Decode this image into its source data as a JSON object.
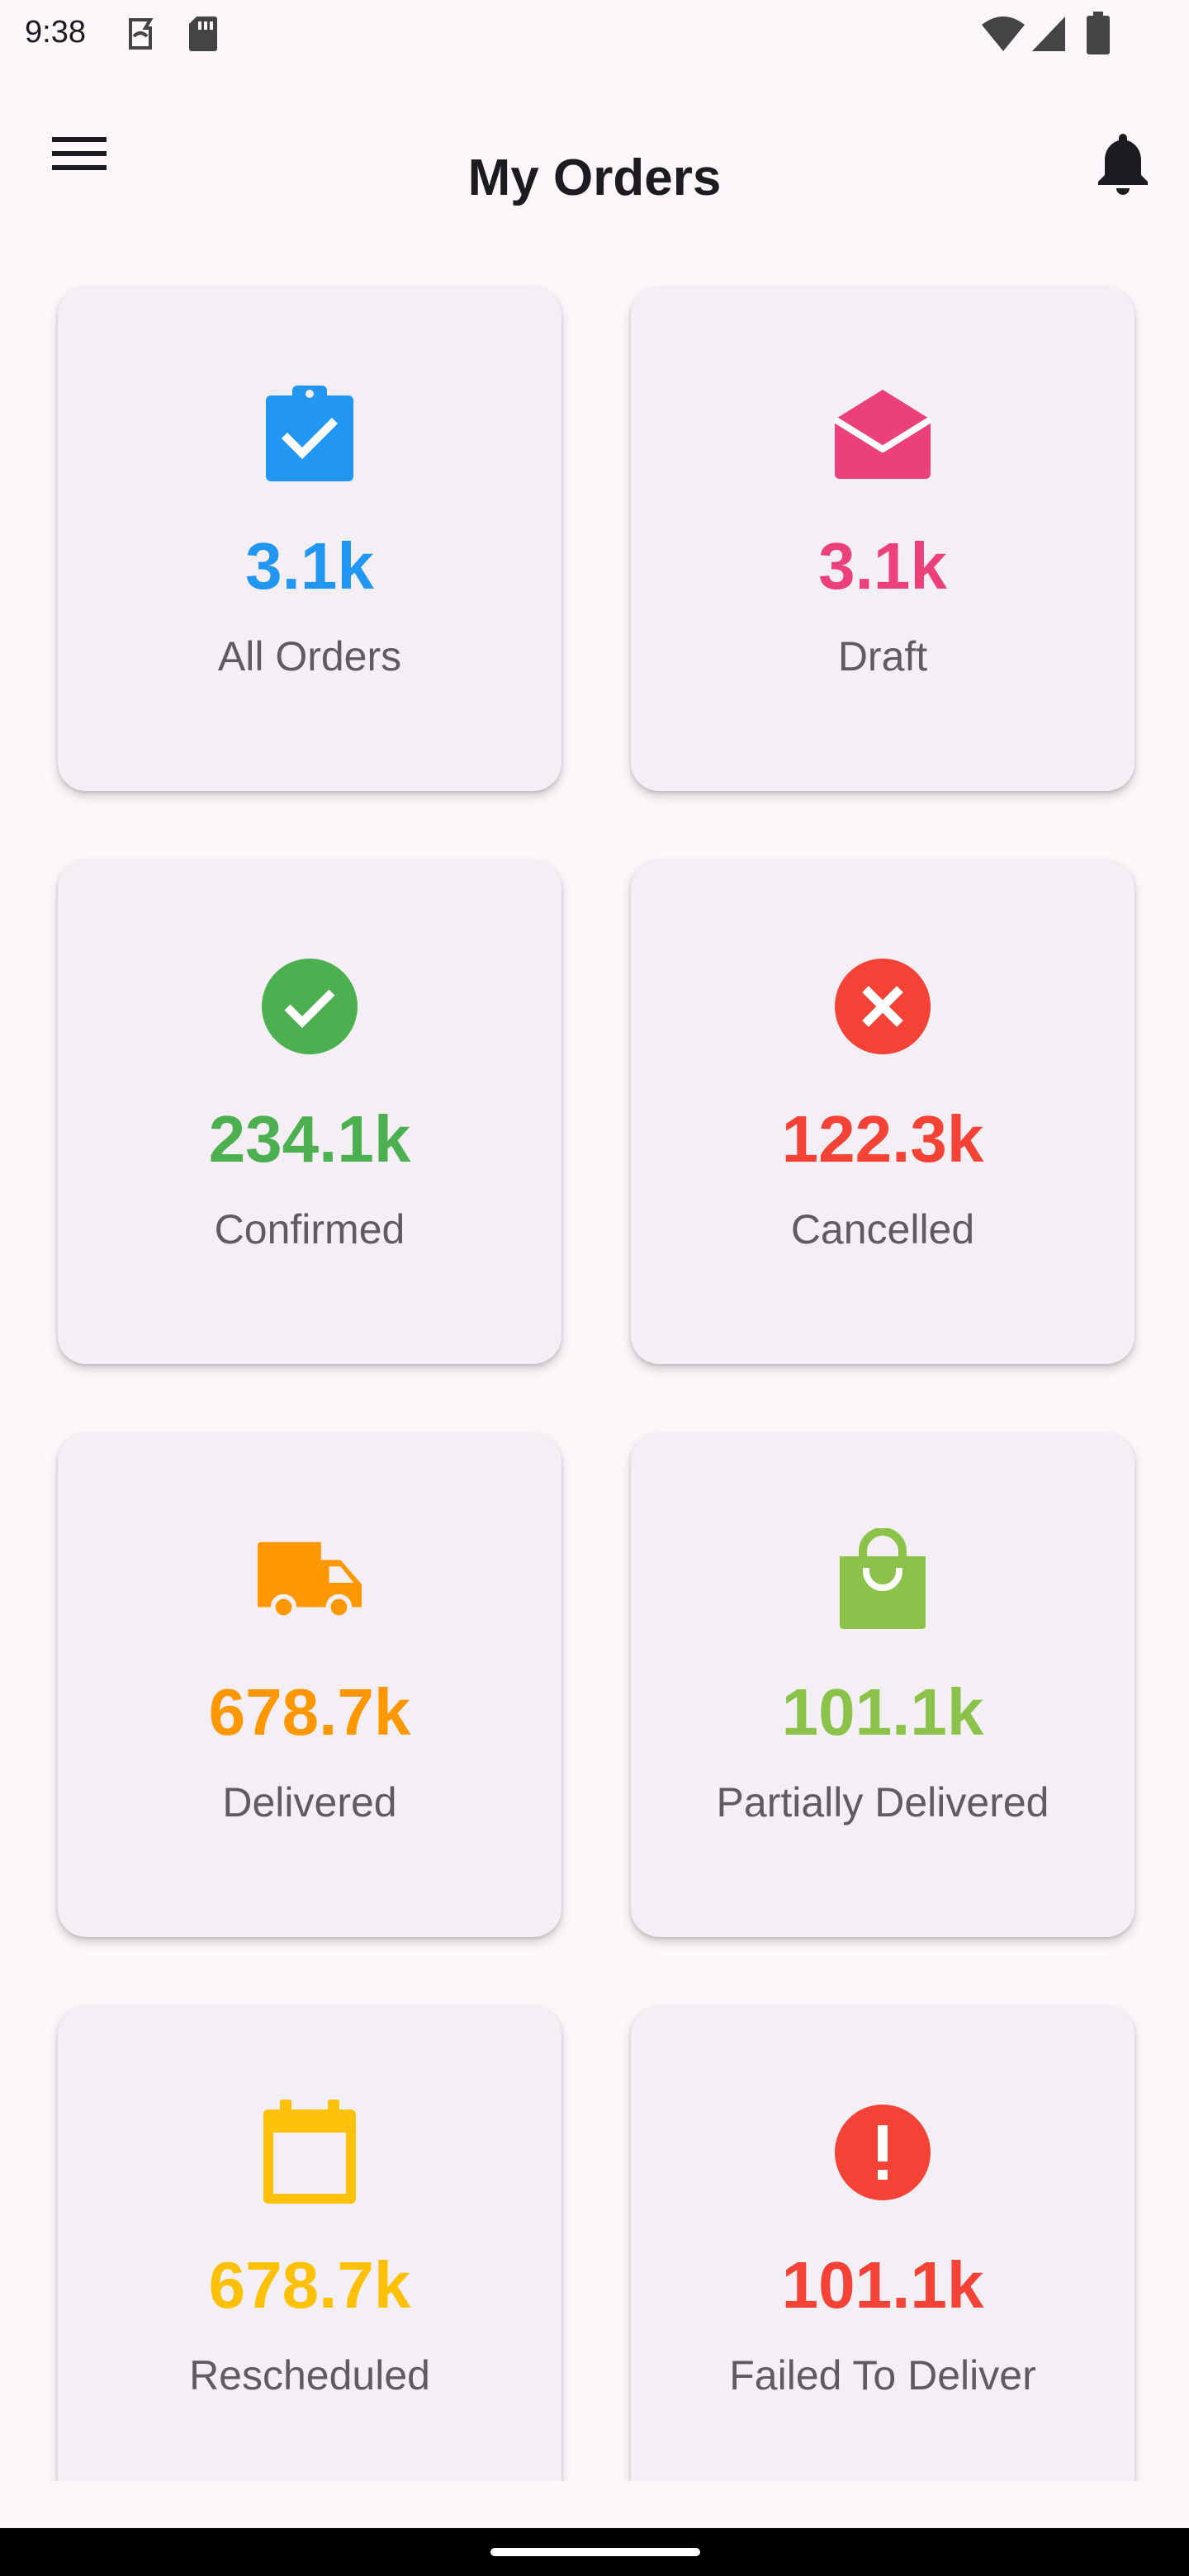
{
  "status_bar": {
    "time": "9:38"
  },
  "header": {
    "title": "My Orders"
  },
  "colors": {
    "blue": "#2196f3",
    "pink": "#ec407a",
    "green": "#4caf50",
    "red": "#f44336",
    "orange": "#ff9800",
    "lightgreen": "#8bc34a",
    "amber": "#ffc107",
    "background": "#fdf7fb",
    "card": "#f4eff4"
  },
  "cards": [
    {
      "value": "3.1k",
      "label": "All Orders",
      "icon": "clipboard-check-icon",
      "color": "#2196f3"
    },
    {
      "value": "3.1k",
      "label": "Draft",
      "icon": "open-envelope-icon",
      "color": "#ec407a"
    },
    {
      "value": "234.1k",
      "label": "Confirmed",
      "icon": "check-circle-icon",
      "color": "#4caf50"
    },
    {
      "value": "122.3k",
      "label": "Cancelled",
      "icon": "cancel-circle-icon",
      "color": "#f44336"
    },
    {
      "value": "678.7k",
      "label": "Delivered",
      "icon": "truck-icon",
      "color": "#ff9800"
    },
    {
      "value": "101.1k",
      "label": "Partially Delivered",
      "icon": "shopping-bag-icon",
      "color": "#8bc34a"
    },
    {
      "value": "678.7k",
      "label": "Rescheduled",
      "icon": "calendar-icon",
      "color": "#ffc107"
    },
    {
      "value": "101.1k",
      "label": "Failed To Deliver",
      "icon": "error-circle-icon",
      "color": "#f44336"
    }
  ]
}
